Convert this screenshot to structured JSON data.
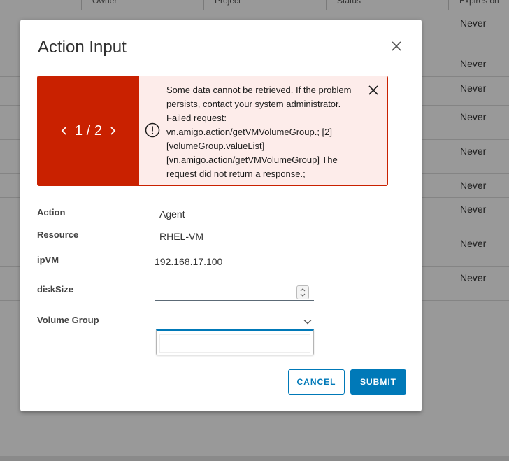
{
  "background": {
    "columns": [
      "Owner",
      "Project",
      "Status",
      "Expires on"
    ],
    "rows": [
      {
        "expires": "Never"
      },
      {
        "expires": "Never"
      },
      {
        "expires": "Never"
      },
      {
        "expires": "Never"
      },
      {
        "expires": "Never"
      },
      {
        "expires": "Never"
      },
      {
        "expires": "Never"
      },
      {
        "expires": "Never"
      },
      {
        "expires": "Never"
      }
    ]
  },
  "modal": {
    "title": "Action Input",
    "close_icon": "close-icon",
    "alert": {
      "pager": "1 / 2",
      "icon": "exclamation-circle-icon",
      "message": "Some data cannot be retrieved. If the problem persists, contact your system administrator. Failed request: vn.amigo.action/getVMVolumeGroup.; [2] [volumeGroup.valueList][vn.amigo.action/getVMVolumeGroup] The request did not return a response.;",
      "color": "#c92100",
      "background": "#fdecea"
    },
    "form": {
      "action_label": "Action",
      "action_value": "Agent",
      "resource_label": "Resource",
      "resource_value": "RHEL-VM",
      "ipvm_label": "ipVM",
      "ipvm_value": "192.168.17.100",
      "disksize_label": "diskSize",
      "disksize_value": "",
      "volume_group_label": "Volume Group",
      "volume_group_value": ""
    },
    "buttons": {
      "cancel": "CANCEL",
      "submit": "SUBMIT"
    },
    "accent": "#0079b8"
  }
}
